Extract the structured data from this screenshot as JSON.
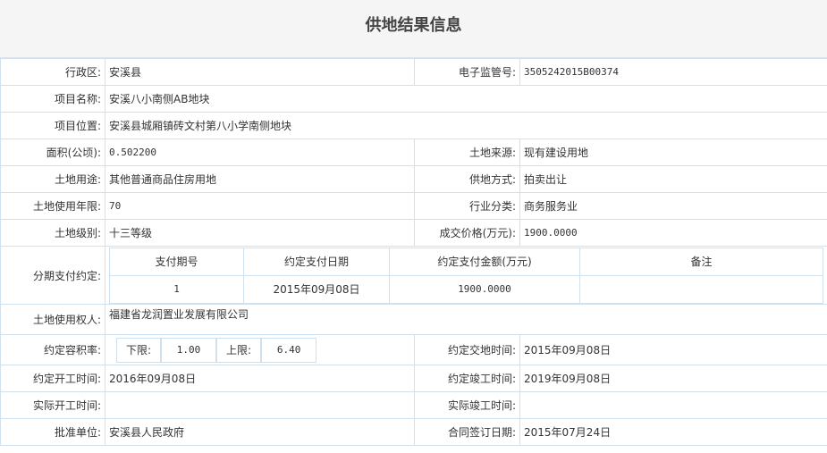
{
  "page_title": "供地结果信息",
  "rows": {
    "district": {
      "label": "行政区:",
      "value": "安溪县"
    },
    "supervision_no": {
      "label": "电子监管号:",
      "value": "3505242015B00374"
    },
    "project_name": {
      "label": "项目名称:",
      "value": "安溪八小南侧AB地块"
    },
    "project_location": {
      "label": "项目位置:",
      "value": "安溪县城厢镇砖文村第八小学南侧地块"
    },
    "area": {
      "label": "面积(公顷):",
      "value": "0.502200"
    },
    "land_source": {
      "label": "土地来源:",
      "value": "现有建设用地"
    },
    "land_use": {
      "label": "土地用途:",
      "value": "其他普通商品住房用地"
    },
    "supply_method": {
      "label": "供地方式:",
      "value": "拍卖出让"
    },
    "use_years": {
      "label": "土地使用年限:",
      "value": "70"
    },
    "industry": {
      "label": "行业分类:",
      "value": "商务服务业"
    },
    "land_level": {
      "label": "土地级别:",
      "value": "十三等级"
    },
    "deal_price": {
      "label": "成交价格(万元):",
      "value": "1900.0000"
    },
    "installments": {
      "label": "分期支付约定:",
      "headers": [
        "支付期号",
        "约定支付日期",
        "约定支付金额(万元)",
        "备注"
      ],
      "rows": [
        [
          "1",
          "2015年09月08日",
          "1900.0000",
          ""
        ]
      ]
    },
    "land_user": {
      "label": "土地使用权人:",
      "value": "福建省龙润置业发展有限公司"
    },
    "far": {
      "label": "约定容积率:",
      "lower_label": "下限:",
      "lower": "1.00",
      "upper_label": "上限:",
      "upper": "6.40"
    },
    "handover_date": {
      "label": "约定交地时间:",
      "value": "2015年09月08日"
    },
    "start_date": {
      "label": "约定开工时间:",
      "value": "2016年09月08日"
    },
    "finish_date": {
      "label": "约定竣工时间:",
      "value": "2019年09月08日"
    },
    "actual_start": {
      "label": "实际开工时间:",
      "value": ""
    },
    "actual_finish": {
      "label": "实际竣工时间:",
      "value": ""
    },
    "approver": {
      "label": "批准单位:",
      "value": "安溪县人民政府"
    },
    "contract_date": {
      "label": "合同签订日期:",
      "value": "2015年07月24日"
    }
  }
}
